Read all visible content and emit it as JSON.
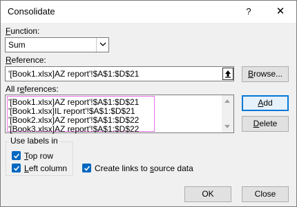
{
  "window": {
    "title": "Consolidate",
    "help_glyph": "?",
    "close_glyph": "✕"
  },
  "function": {
    "label_prefix": "",
    "label_access": "F",
    "label_rest": "unction:",
    "value": "Sum"
  },
  "reference": {
    "label_access": "R",
    "label_rest": "eference:",
    "value": "'[Book1.xlsx]AZ report'!$A$1:$D$21",
    "browse_access": "B",
    "browse_rest": "rowse..."
  },
  "all_references": {
    "label_pre": "All r",
    "label_access": "e",
    "label_rest": "ferences:",
    "items": [
      "'[Book1.xlsx]AZ report'!$A$1:$D$21",
      "'[Book1.xlsx]IL report'!$A$1:$D$21",
      "'[Book2.xlsx]AZ report'!$A$1:$D$22",
      "'[Book3.xlsx]AZ report'!$A$1:$D$22"
    ],
    "add_access": "A",
    "add_rest": "dd",
    "delete_access": "D",
    "delete_rest": "elete"
  },
  "labels": {
    "group_title": "Use labels in",
    "top_row_access": "T",
    "top_row_rest": "op row",
    "top_row_checked": true,
    "left_column_access": "L",
    "left_column_rest": "eft column",
    "left_column_checked": true,
    "links_pre": "Create links to ",
    "links_access": "s",
    "links_rest": "ource data",
    "links_checked": true
  },
  "footer": {
    "ok": "OK",
    "close": "Close"
  },
  "colors": {
    "accent": "#0078d7",
    "checkbox": "#0067c0",
    "highlight": "#e86ee8"
  }
}
